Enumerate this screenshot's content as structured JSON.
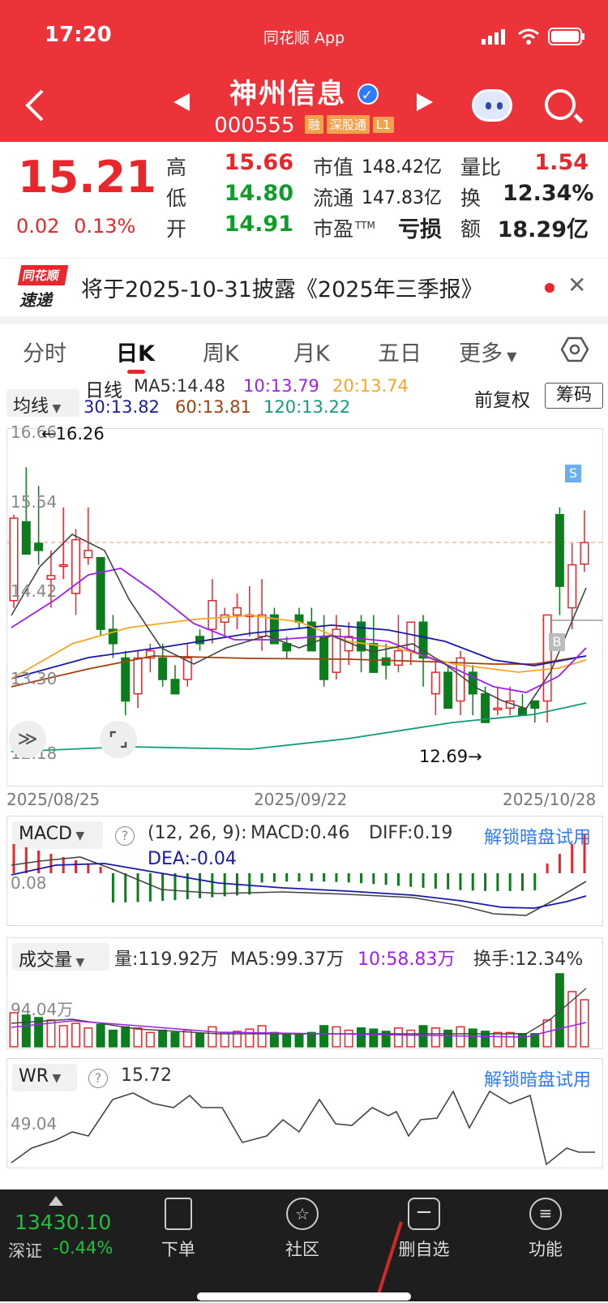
{
  "status": {
    "time": "17:20",
    "app": "同花顺 App"
  },
  "header": {
    "name": "神州信息",
    "code": "000555",
    "tags": [
      "融",
      "深股通",
      "L1"
    ]
  },
  "quote": {
    "price": "15.21",
    "change": "0.02",
    "change_pct": "0.13%",
    "high_label": "高",
    "high": "15.66",
    "low_label": "低",
    "low": "14.80",
    "open_label": "开",
    "open": "14.91",
    "mktcap_label": "市值",
    "mktcap": "148.42亿",
    "float_label": "流通",
    "float": "147.83亿",
    "pe_label": "市盈",
    "pe_sup": "TTM",
    "pe": "亏损",
    "vr_label": "量比",
    "vr": "1.54",
    "turnover_label": "换",
    "turnover": "12.34%",
    "amount_label": "额",
    "amount": "18.29亿"
  },
  "news": {
    "logo_top": "同花顺",
    "logo_bottom": "速递",
    "text": "将于2025-10-31披露《2025年三季报》"
  },
  "tabs": [
    "分时",
    "日K",
    "周K",
    "月K",
    "五日",
    "更多"
  ],
  "ma_bar": {
    "select": "均线",
    "title": "日线",
    "ma5": "MA5:14.48",
    "ma10": "10:13.79",
    "ma20": "20:13.74",
    "ma30": "30:13.82",
    "ma60": "60:13.81",
    "ma120": "120:13.22",
    "adjust": "前复权",
    "chips": "筹码"
  },
  "kline_axis": {
    "y_labels": [
      "16.66",
      "15.54",
      "14.42",
      "13.30",
      "12.18"
    ],
    "x_labels": [
      "2025/08/25",
      "2025/09/22",
      "2025/10/28"
    ],
    "high_mark": "←16.26",
    "low_mark": "12.69→",
    "sell_tag": "S",
    "buy_tag": "B"
  },
  "macd": {
    "select": "MACD",
    "params": "(12, 26, 9):",
    "macd": "MACD:0.46",
    "diff": "DIFF:0.19",
    "dea": "DEA:-0.04",
    "axis": "0.08",
    "unlock": "解锁暗盘试用"
  },
  "volume": {
    "select": "成交量",
    "vol": "量:119.92万",
    "ma5": "MA5:99.37万",
    "ma10": "10:58.83万",
    "turnover": "换手:12.34%",
    "axis": "94.04万"
  },
  "wr": {
    "select": "WR",
    "value": "15.72",
    "axis": "49.04",
    "unlock": "解锁暗盘试用"
  },
  "bottom": {
    "index_value": "13430.10",
    "index_name": "深证",
    "index_change": "-0.44%",
    "nav": [
      "下单",
      "社区",
      "删自选",
      "功能"
    ]
  },
  "chart_data": {
    "type": "candlestick",
    "x_range": [
      "2025/08/25",
      "2025/10/28"
    ],
    "ylim": [
      12.18,
      16.66
    ],
    "ohlc": [
      [
        14.4,
        15.6,
        14.3,
        15.55
      ],
      [
        15.5,
        16.26,
        15.1,
        15.05
      ],
      [
        15.2,
        16.0,
        14.9,
        15.1
      ],
      [
        14.7,
        15.1,
        14.3,
        14.75
      ],
      [
        14.9,
        15.7,
        14.7,
        14.9
      ],
      [
        14.5,
        15.4,
        14.2,
        15.25
      ],
      [
        15.0,
        15.7,
        14.9,
        15.1
      ],
      [
        15.0,
        15.0,
        13.9,
        14.0
      ],
      [
        14.0,
        14.2,
        13.6,
        13.8
      ],
      [
        13.6,
        13.7,
        12.8,
        13.0
      ],
      [
        13.1,
        13.7,
        12.9,
        13.6
      ],
      [
        13.6,
        13.8,
        13.4,
        13.7
      ],
      [
        13.6,
        13.8,
        13.2,
        13.3
      ],
      [
        13.3,
        13.5,
        13.1,
        13.1
      ],
      [
        13.3,
        13.8,
        13.2,
        13.6
      ],
      [
        13.9,
        14.0,
        13.7,
        13.8
      ],
      [
        14.0,
        14.7,
        13.8,
        14.4
      ],
      [
        14.1,
        14.3,
        13.9,
        14.2
      ],
      [
        14.2,
        14.5,
        14.0,
        14.3
      ],
      [
        14.2,
        14.6,
        13.9,
        14.2
      ],
      [
        13.9,
        14.7,
        13.7,
        14.2
      ],
      [
        14.2,
        14.3,
        13.9,
        13.8
      ],
      [
        13.8,
        13.9,
        13.6,
        13.7
      ],
      [
        14.2,
        14.3,
        14.0,
        14.1
      ],
      [
        14.1,
        14.3,
        13.9,
        13.7
      ],
      [
        13.9,
        14.2,
        13.2,
        13.3
      ],
      [
        13.4,
        14.2,
        13.3,
        14.0
      ],
      [
        13.7,
        14.1,
        13.5,
        13.9
      ],
      [
        14.1,
        14.2,
        13.4,
        13.7
      ],
      [
        13.8,
        14.2,
        13.5,
        13.4
      ],
      [
        13.6,
        13.8,
        13.3,
        13.5
      ],
      [
        13.5,
        14.2,
        13.4,
        13.7
      ],
      [
        13.7,
        14.1,
        13.5,
        14.1
      ],
      [
        14.1,
        14.2,
        13.2,
        13.6
      ],
      [
        13.1,
        13.6,
        12.8,
        13.4
      ],
      [
        13.4,
        13.5,
        12.9,
        12.9
      ],
      [
        13.0,
        13.7,
        12.8,
        13.6
      ],
      [
        13.4,
        13.5,
        12.8,
        13.1
      ],
      [
        13.1,
        13.2,
        12.69,
        12.7
      ],
      [
        12.9,
        13.2,
        12.8,
        12.9
      ],
      [
        12.9,
        13.2,
        12.8,
        13.0
      ],
      [
        12.9,
        13.1,
        12.8,
        12.8
      ],
      [
        13.0,
        13.0,
        12.7,
        12.9
      ],
      [
        13.0,
        14.2,
        12.7,
        14.2
      ],
      [
        15.6,
        15.7,
        14.2,
        14.6
      ],
      [
        14.3,
        15.2,
        14.0,
        14.9
      ],
      [
        14.91,
        15.66,
        14.8,
        15.21
      ]
    ]
  }
}
